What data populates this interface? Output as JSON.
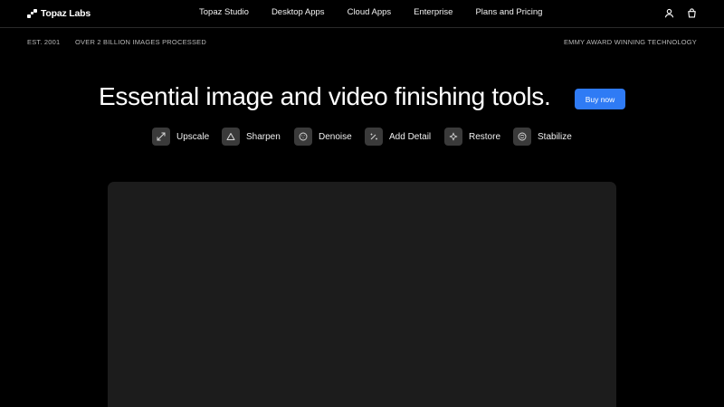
{
  "brand": {
    "name": "Topaz Labs"
  },
  "nav": {
    "links": [
      "Topaz Studio",
      "Desktop Apps",
      "Cloud Apps",
      "Enterprise",
      "Plans and Pricing"
    ],
    "icons": [
      "account-icon",
      "cart-icon"
    ]
  },
  "subbar": {
    "est": "EST. 2001",
    "processed": "OVER 2 BILLION IMAGES PROCESSED",
    "award": "EMMY AWARD WINNING TECHNOLOGY"
  },
  "hero": {
    "title": "Essential image and video finishing tools.",
    "cta": "Buy now"
  },
  "features": [
    {
      "label": "Upscale",
      "icon": "expand-arrows-icon"
    },
    {
      "label": "Sharpen",
      "icon": "triangle-icon"
    },
    {
      "label": "Denoise",
      "icon": "noise-circle-icon"
    },
    {
      "label": "Add Detail",
      "icon": "sparkle-wand-icon"
    },
    {
      "label": "Restore",
      "icon": "star-sparkle-icon"
    },
    {
      "label": "Stabilize",
      "icon": "swirl-icon"
    }
  ],
  "colors": {
    "background": "#000000",
    "accent": "#2f7bf5",
    "panel": "#1c1c1c",
    "chip": "#3a3a3a"
  }
}
